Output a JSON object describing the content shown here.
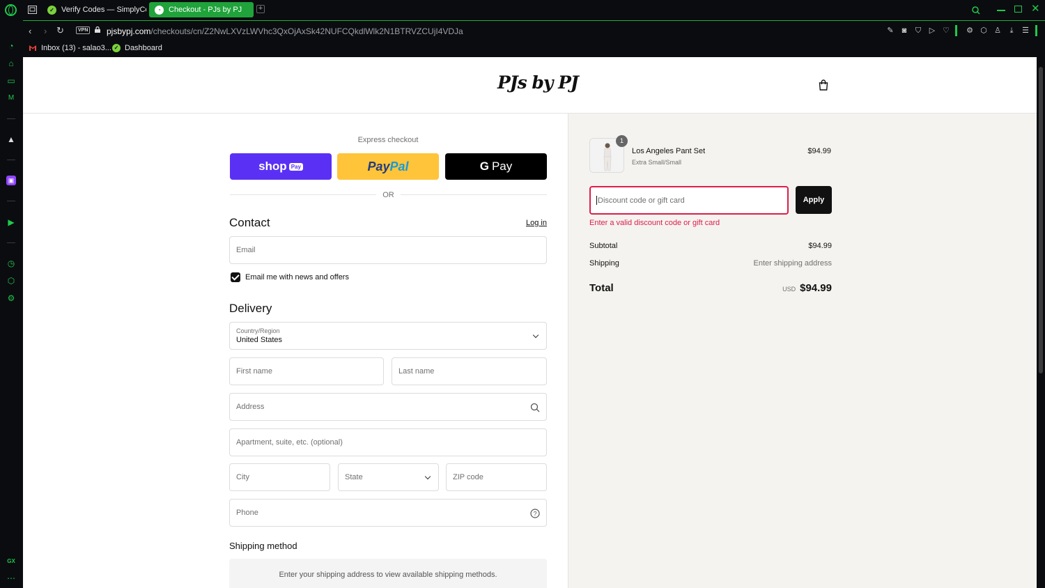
{
  "browser": {
    "tabs": [
      {
        "label": "Verify Codes — SimplyCo",
        "active": false
      },
      {
        "label": "Checkout - PJs by PJ",
        "active": true
      }
    ],
    "url_host": "pjsbypj.com",
    "url_path": "/checkouts/cn/Z2NwLXVzLWVhc3QxOjAxSk42NUFCQkdlWlk2N1BTRVZCUjI4VDJa",
    "vpn_label": "VPN",
    "bookmarks": [
      {
        "label": "Inbox (13) - salao3...",
        "icon": "gmail-icon"
      },
      {
        "label": "Dashboard",
        "icon": "check-badge-icon"
      }
    ],
    "accent_color": "#1fc94a"
  },
  "store": {
    "name": "PJs by PJ"
  },
  "checkout": {
    "express_label": "Express checkout",
    "shoppay_label": "shop",
    "shoppay_badge": "Pay",
    "paypal_part1": "Pay",
    "paypal_part2": "Pal",
    "gpay_g": "G",
    "gpay_label": "Pay",
    "or_label": "OR",
    "contact_heading": "Contact",
    "login_label": "Log in",
    "email_placeholder": "Email",
    "newsletter_label": "Email me with news and offers",
    "newsletter_checked": true,
    "delivery_heading": "Delivery",
    "country_label": "Country/Region",
    "country_value": "United States",
    "first_name_placeholder": "First name",
    "last_name_placeholder": "Last name",
    "address_placeholder": "Address",
    "apartment_placeholder": "Apartment, suite, etc. (optional)",
    "city_placeholder": "City",
    "state_placeholder": "State",
    "zip_placeholder": "ZIP code",
    "phone_placeholder": "Phone",
    "shipping_method_heading": "Shipping method",
    "shipping_method_note": "Enter your shipping address to view available shipping methods."
  },
  "summary": {
    "item": {
      "quantity": "1",
      "name": "Los Angeles Pant Set",
      "variant": "Extra Small/Small",
      "price": "$94.99"
    },
    "discount_placeholder": "Discount code or gift card",
    "apply_label": "Apply",
    "discount_error": "Enter a valid discount code or gift card",
    "subtotal_label": "Subtotal",
    "subtotal_value": "$94.99",
    "shipping_label": "Shipping",
    "shipping_value": "Enter shipping address",
    "total_label": "Total",
    "total_currency": "USD",
    "total_value": "$94.99",
    "error_color": "#dd1d4a"
  }
}
